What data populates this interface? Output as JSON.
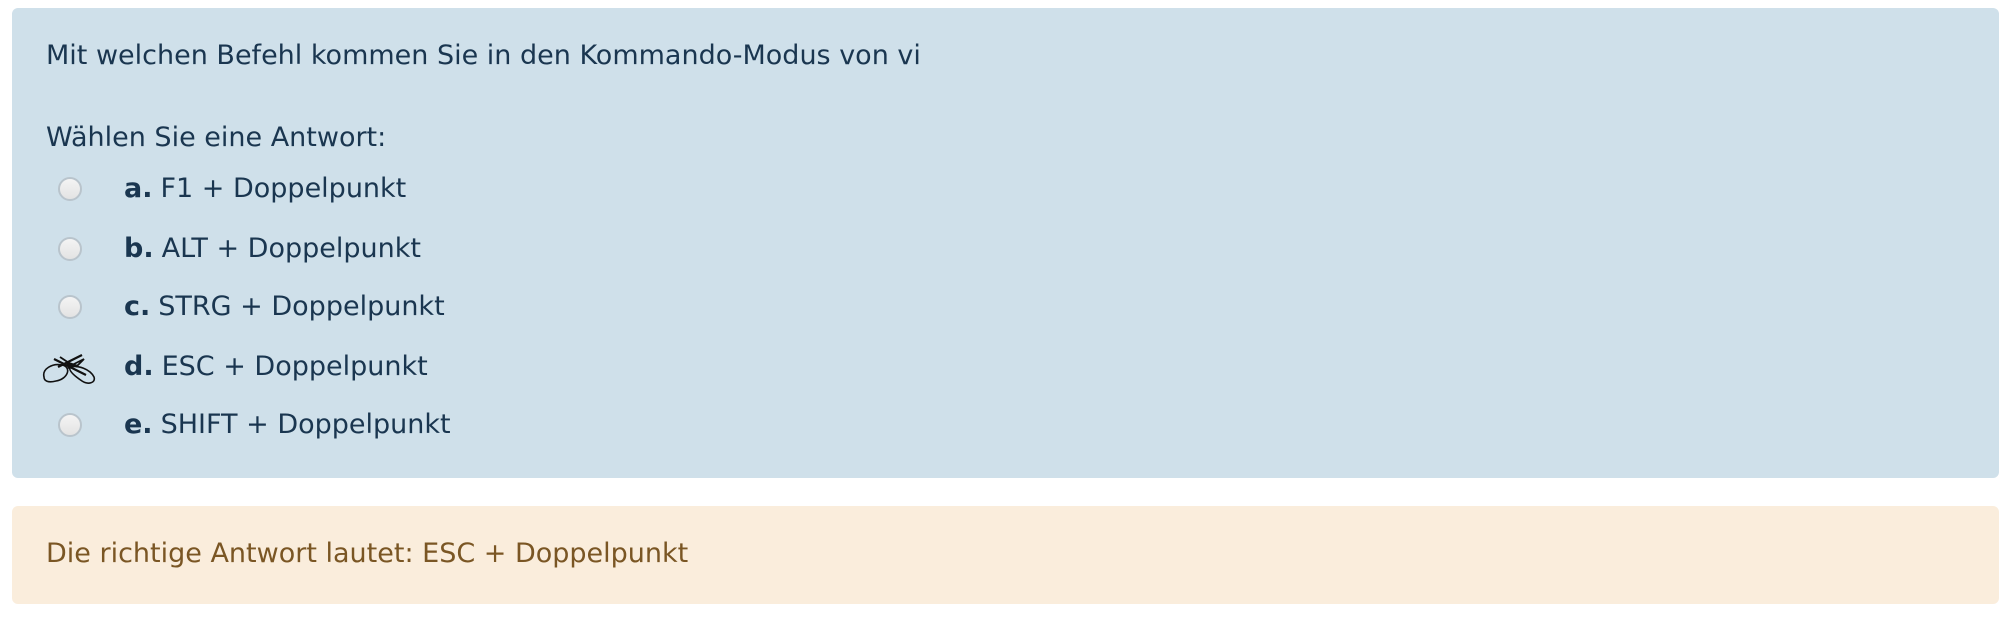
{
  "question": {
    "text": "Mit welchen Befehl kommen Sie in den Kommando-Modus von vi",
    "prompt": "Wählen Sie eine Antwort:"
  },
  "answers": [
    {
      "letter": "a.",
      "text": "F1 + Doppelpunkt",
      "selected": false
    },
    {
      "letter": "b.",
      "text": "ALT + Doppelpunkt",
      "selected": false
    },
    {
      "letter": "c.",
      "text": "STRG + Doppelpunkt",
      "selected": false
    },
    {
      "letter": "d.",
      "text": "ESC + Doppelpunkt",
      "selected": true
    },
    {
      "letter": "e.",
      "text": "SHIFT + Doppelpunkt",
      "selected": false
    }
  ],
  "feedback": {
    "text": "Die richtige Antwort lautet: ESC + Doppelpunkt"
  },
  "colors": {
    "question_bg": "#cfe0ea",
    "text": "#1a3650",
    "feedback_bg": "#faeddc",
    "feedback_text": "#7a5624"
  },
  "icons": {
    "unselected": "radio-unchecked-icon",
    "selected": "hand-drawn-check-mark-icon"
  }
}
